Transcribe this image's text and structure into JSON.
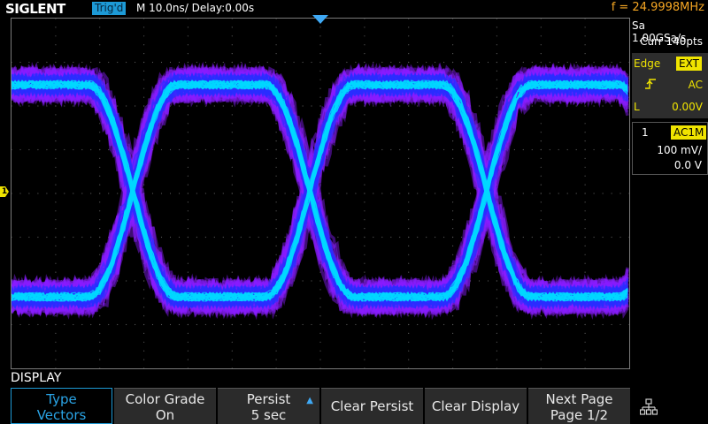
{
  "header": {
    "brand": "SIGLENT",
    "trigger_status": "Trig'd",
    "timebase": "M 10.0ns/",
    "delay": "Delay:0.00s",
    "frequency": "f = 24.9998MHz"
  },
  "acquisition": {
    "sample_rate": "Sa 1.00GSa/s",
    "memory": "Curr 140pts"
  },
  "trigger": {
    "type": "Edge",
    "source": "EXT",
    "slope_icon": "rising-edge-icon",
    "coupling": "AC",
    "level_label": "L",
    "level": "0.00V"
  },
  "channel": {
    "number": "1",
    "coupling": "AC1M",
    "scale": "100 mV/",
    "offset": "0.0 V",
    "marker": "1",
    "color": "#f0e400"
  },
  "menu": {
    "title": "DISPLAY",
    "softkeys": [
      {
        "line1": "Type",
        "line2": "Vectors",
        "active": true
      },
      {
        "line1": "Color Grade",
        "line2": "On"
      },
      {
        "line1": "Persist",
        "line2": "5 sec",
        "arrow": "up-arrow-icon"
      },
      {
        "line1": "Clear Persist"
      },
      {
        "line1": "Clear Display"
      },
      {
        "line1": "Next Page",
        "line2": "Page 1/2"
      }
    ],
    "network_icon": "network-icon"
  },
  "colors": {
    "accent": "#1d9ad6",
    "frequency": "#f5a623",
    "waveform_core": "#00e5ff",
    "waveform_mid": "#1a3cff",
    "waveform_edge": "#9b1dff"
  }
}
